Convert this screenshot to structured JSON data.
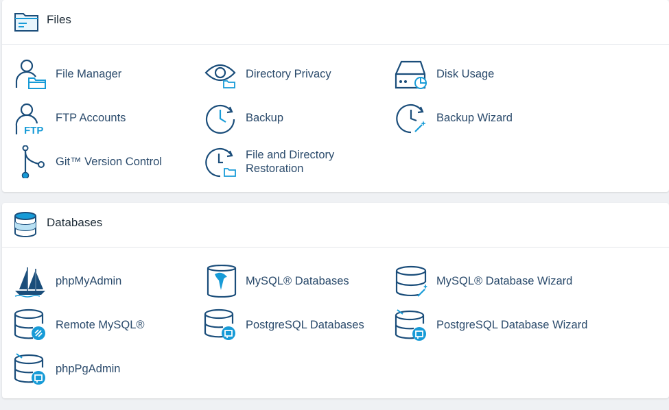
{
  "files": {
    "title": "Files",
    "header_icon": "folder-icon",
    "items": [
      {
        "label": "File Manager",
        "icon": "user-folder-icon"
      },
      {
        "label": "Directory Privacy",
        "icon": "eye-folder-icon"
      },
      {
        "label": "Disk Usage",
        "icon": "disk-chart-icon"
      },
      {
        "label": "FTP Accounts",
        "icon": "user-ftp-icon"
      },
      {
        "label": "Backup",
        "icon": "clock-arrow-icon"
      },
      {
        "label": "Backup Wizard",
        "icon": "clock-wand-icon"
      },
      {
        "label": "Git™ Version Control",
        "icon": "git-branch-icon"
      },
      {
        "label": "File and Directory Restoration",
        "icon": "clock-folder-icon"
      }
    ]
  },
  "databases": {
    "title": "Databases",
    "header_icon": "database-icon",
    "items": [
      {
        "label": "phpMyAdmin",
        "icon": "sailboat-icon"
      },
      {
        "label": "MySQL® Databases",
        "icon": "mysql-dolphin-icon"
      },
      {
        "label": "MySQL® Database Wizard",
        "icon": "database-wand-icon"
      },
      {
        "label": "Remote MySQL®",
        "icon": "database-remote-icon"
      },
      {
        "label": "PostgreSQL Databases",
        "icon": "database-elephant-icon"
      },
      {
        "label": "PostgreSQL Database Wizard",
        "icon": "database-elephant-wand-icon"
      },
      {
        "label": "phpPgAdmin",
        "icon": "database-elephant-admin-icon"
      }
    ]
  },
  "colors": {
    "icon_dark": "#1a4d7a",
    "icon_light": "#179bd7",
    "label": "#2a4a6b",
    "background": "#eff1f4"
  }
}
